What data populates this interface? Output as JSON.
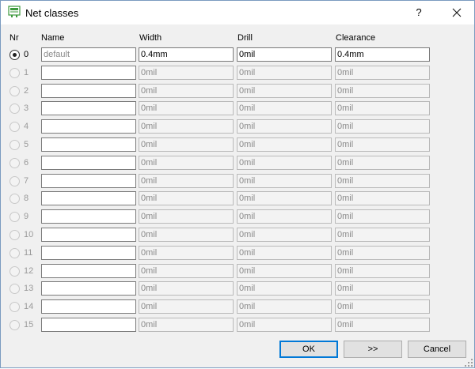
{
  "window": {
    "title": "Net classes",
    "help_label": "?"
  },
  "headers": {
    "nr": "Nr",
    "name": "Name",
    "width": "Width",
    "drill": "Drill",
    "clearance": "Clearance"
  },
  "rows": [
    {
      "nr": "0",
      "name": "default",
      "width": "0.4mm",
      "drill": "0mil",
      "clearance": "0.4mm",
      "selected": true
    },
    {
      "nr": "1",
      "name": "",
      "width": "0mil",
      "drill": "0mil",
      "clearance": "0mil",
      "selected": false
    },
    {
      "nr": "2",
      "name": "",
      "width": "0mil",
      "drill": "0mil",
      "clearance": "0mil",
      "selected": false
    },
    {
      "nr": "3",
      "name": "",
      "width": "0mil",
      "drill": "0mil",
      "clearance": "0mil",
      "selected": false
    },
    {
      "nr": "4",
      "name": "",
      "width": "0mil",
      "drill": "0mil",
      "clearance": "0mil",
      "selected": false
    },
    {
      "nr": "5",
      "name": "",
      "width": "0mil",
      "drill": "0mil",
      "clearance": "0mil",
      "selected": false
    },
    {
      "nr": "6",
      "name": "",
      "width": "0mil",
      "drill": "0mil",
      "clearance": "0mil",
      "selected": false
    },
    {
      "nr": "7",
      "name": "",
      "width": "0mil",
      "drill": "0mil",
      "clearance": "0mil",
      "selected": false
    },
    {
      "nr": "8",
      "name": "",
      "width": "0mil",
      "drill": "0mil",
      "clearance": "0mil",
      "selected": false
    },
    {
      "nr": "9",
      "name": "",
      "width": "0mil",
      "drill": "0mil",
      "clearance": "0mil",
      "selected": false
    },
    {
      "nr": "10",
      "name": "",
      "width": "0mil",
      "drill": "0mil",
      "clearance": "0mil",
      "selected": false
    },
    {
      "nr": "11",
      "name": "",
      "width": "0mil",
      "drill": "0mil",
      "clearance": "0mil",
      "selected": false
    },
    {
      "nr": "12",
      "name": "",
      "width": "0mil",
      "drill": "0mil",
      "clearance": "0mil",
      "selected": false
    },
    {
      "nr": "13",
      "name": "",
      "width": "0mil",
      "drill": "0mil",
      "clearance": "0mil",
      "selected": false
    },
    {
      "nr": "14",
      "name": "",
      "width": "0mil",
      "drill": "0mil",
      "clearance": "0mil",
      "selected": false
    },
    {
      "nr": "15",
      "name": "",
      "width": "0mil",
      "drill": "0mil",
      "clearance": "0mil",
      "selected": false
    }
  ],
  "buttons": {
    "ok": "OK",
    "more": ">>",
    "cancel": "Cancel"
  },
  "icons": {
    "app": "net-classes-icon",
    "close": "close-icon",
    "grip": "resize-grip-icon"
  },
  "colors": {
    "focus": "#0078d7",
    "app_icon": "#3c9a3c"
  }
}
